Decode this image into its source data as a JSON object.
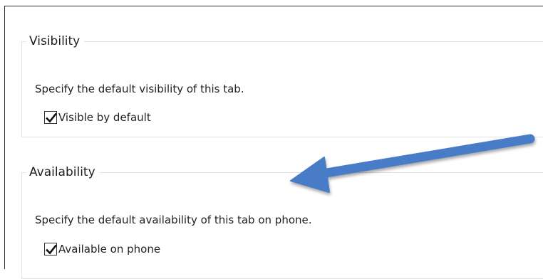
{
  "sections": {
    "visibility": {
      "title": "Visibility",
      "description": "Specify the default visibility of this tab.",
      "checkbox_label": "Visible by default",
      "checked": true
    },
    "availability": {
      "title": "Availability",
      "description": "Specify the default availability of this tab on phone.",
      "checkbox_label": "Available on phone",
      "checked": true
    }
  },
  "annotation": {
    "icon": "arrow-annotation-icon",
    "color": "#4a7bc7"
  },
  "colors": {
    "group_border": "#e1e1e1",
    "frame_border": "#2b2b2b"
  }
}
